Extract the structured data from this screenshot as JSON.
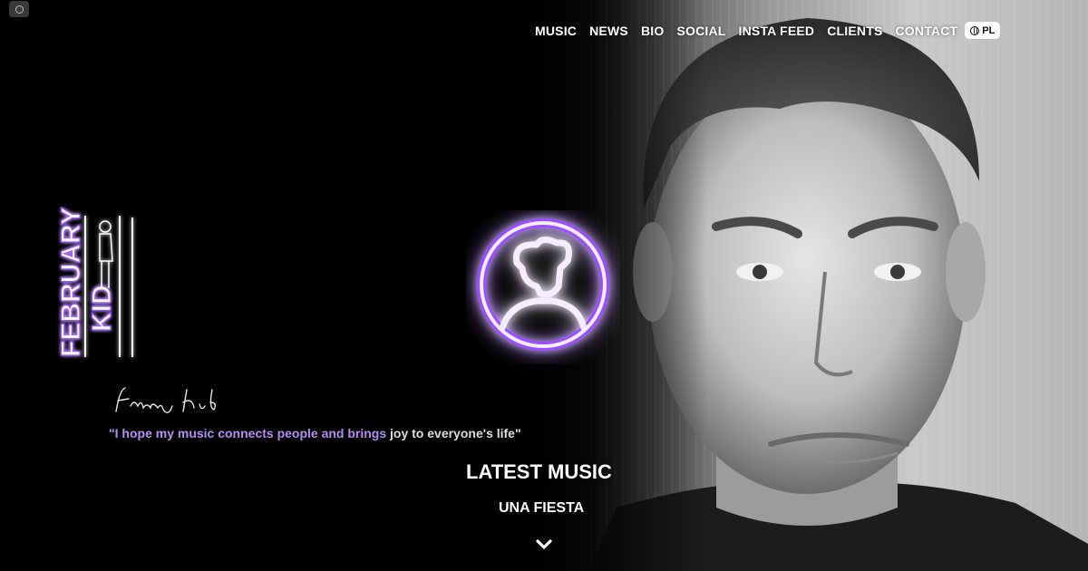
{
  "nav": {
    "items": [
      "MUSIC",
      "NEWS",
      "BIO",
      "SOCIAL",
      "INSTA FEED",
      "CLIENTS",
      "CONTACT"
    ],
    "language": "PL",
    "language_icon": "globe-icon"
  },
  "brand": {
    "logo_word1": "FEBRUARY",
    "logo_word2": "KID",
    "signature": "February Kid",
    "accent_color": "#9b4dff"
  },
  "quote": {
    "highlight": "\"I hope my music connects people and brings ",
    "rest": "joy to everyone's life\""
  },
  "latest": {
    "heading": "LATEST MUSIC",
    "track": "UNA FIESTA",
    "scroll_icon": "chevron-down-icon"
  },
  "corner_icon": "menu-circle-icon"
}
